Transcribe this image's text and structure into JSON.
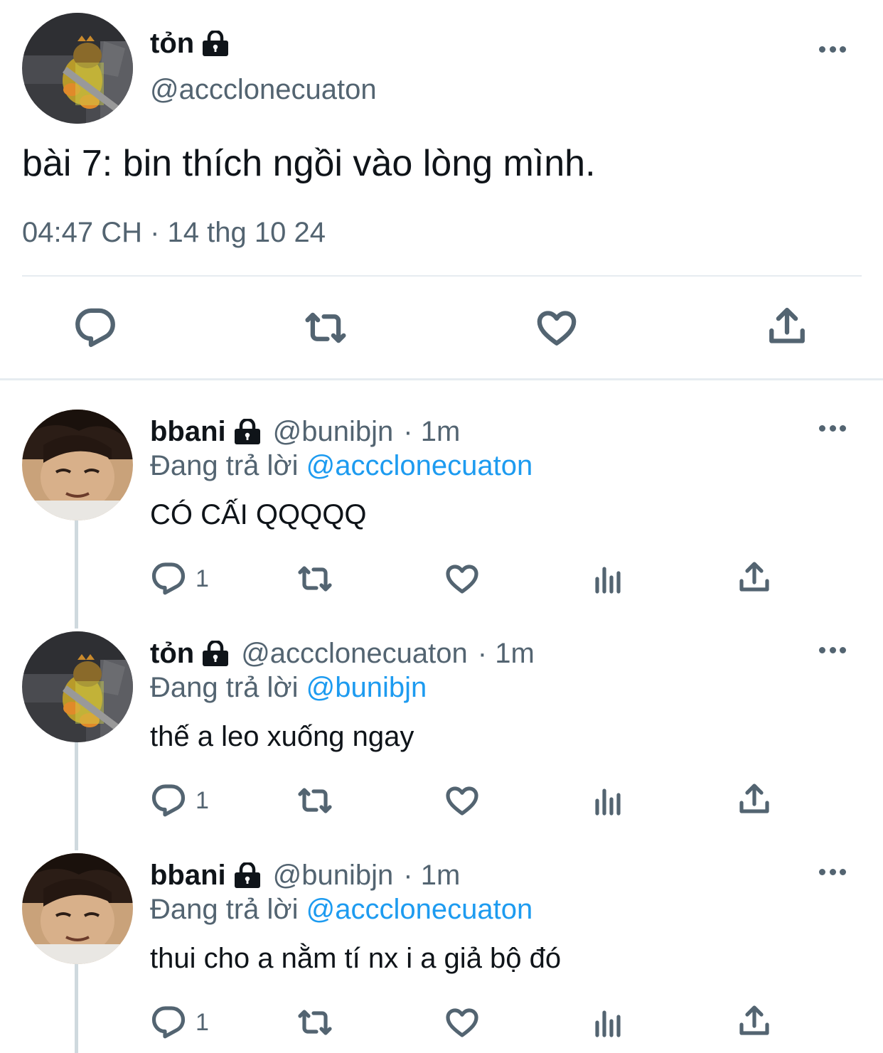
{
  "main_tweet": {
    "display_name": "tỏn",
    "handle": "@accclonecuaton",
    "text": "bài 7: bin thích ngồi vào lòng mình.",
    "timestamp": "04:47 CH · 14 thg 10 24",
    "avatar_icon": "dinosaur-plush-avatar"
  },
  "replies": [
    {
      "display_name": "bbani",
      "handle": "@bunibjn",
      "time": "· 1m",
      "replying_prefix": "Đang trả lời",
      "replying_to": "@accclonecuaton",
      "text": "CÓ CẤI QQQQQ",
      "reply_count": "1",
      "avatar_icon": "person-face-avatar"
    },
    {
      "display_name": "tỏn",
      "handle": "@accclonecuaton",
      "time": "· 1m",
      "replying_prefix": "Đang trả lời",
      "replying_to": "@bunibjn",
      "text": "thế a leo xuống ngay",
      "reply_count": "1",
      "avatar_icon": "dinosaur-plush-avatar"
    },
    {
      "display_name": "bbani",
      "handle": "@bunibjn",
      "time": "· 1m",
      "replying_prefix": "Đang trả lời",
      "replying_to": "@accclonecuaton",
      "text": "thui cho a nằm tí nx i a giả bộ đó",
      "reply_count": "1",
      "avatar_icon": "person-face-avatar"
    }
  ],
  "colors": {
    "text": "#0f1419",
    "secondary": "#536471",
    "link": "#1d9bf0",
    "divider": "#cfd9de"
  }
}
